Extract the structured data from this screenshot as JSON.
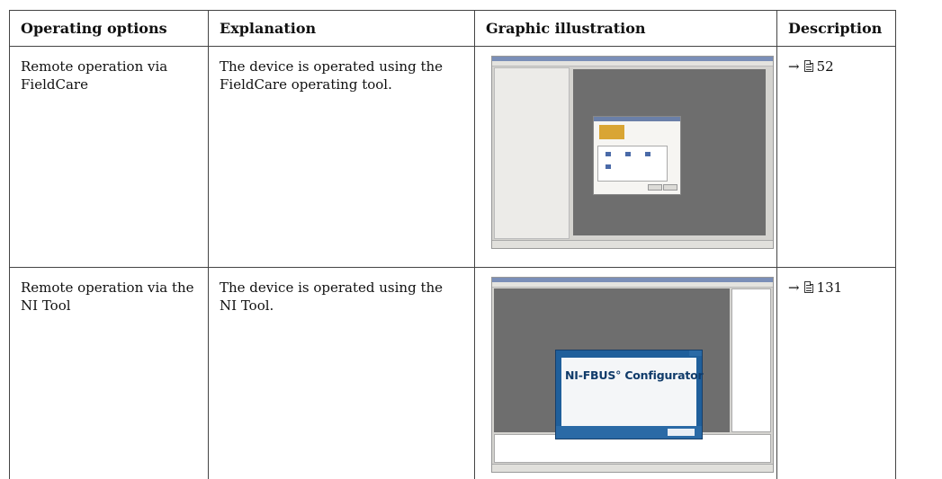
{
  "headers": {
    "operating_options": "Operating options",
    "explanation": "Explanation",
    "graphic_illustration": "Graphic illustration",
    "description": "Description"
  },
  "rows": [
    {
      "option": "Remote operation via FieldCare",
      "explanation": "The device is operated using the FieldCare operating tool.",
      "graphic": "FieldCare software screenshot",
      "arrow": "→",
      "page_ref": "52"
    },
    {
      "option": "Remote operation via the NI Tool",
      "explanation": "The device is operated using the NI Tool.",
      "graphic": "NI-FBUS Configurator software screenshot",
      "splash_title": "NI-FBUS° Configurator",
      "arrow": "→",
      "page_ref": "131"
    }
  ]
}
